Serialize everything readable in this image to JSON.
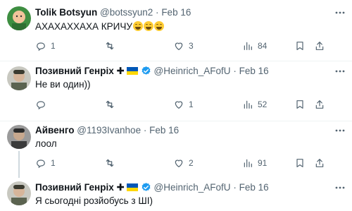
{
  "tweets": [
    {
      "name": "Tolik Botsyun",
      "handle": "@botssyun2",
      "date": "Feb 16",
      "text": "АХАХАХХАХА КРИЧУ",
      "emoji_count": 3,
      "replies": "1",
      "retweets": "",
      "likes": "3",
      "views": "84",
      "flag": false,
      "verified": false,
      "avatar_color": "#3e8e41"
    },
    {
      "name": "Позивний Генріх ✚",
      "handle": "@Heinrich_AFofU",
      "date": "Feb 16",
      "text": "Не ви один))",
      "replies": "",
      "retweets": "",
      "likes": "1",
      "views": "52",
      "flag": true,
      "verified": true,
      "avatar_color": "#5b6350"
    },
    {
      "name": "Айвенго",
      "handle": "@1193Ivanhoe",
      "date": "Feb 16",
      "text": "лоол",
      "replies": "1",
      "retweets": "",
      "likes": "2",
      "views": "91",
      "flag": false,
      "verified": false,
      "avatar_color": "#3b3b3b"
    },
    {
      "name": "Позивний Генріх ✚",
      "handle": "@Heinrich_AFofU",
      "date": "Feb 16",
      "text": "Я сьогодні розйобусь з ШІ)",
      "flag": true,
      "verified": true,
      "avatar_color": "#5b6350"
    }
  ],
  "colors": {
    "text": "#0f1419",
    "muted": "#536471",
    "verified_blue": "#1d9bf0",
    "flag_blue": "#0057b7",
    "flag_yellow": "#ffd700"
  }
}
